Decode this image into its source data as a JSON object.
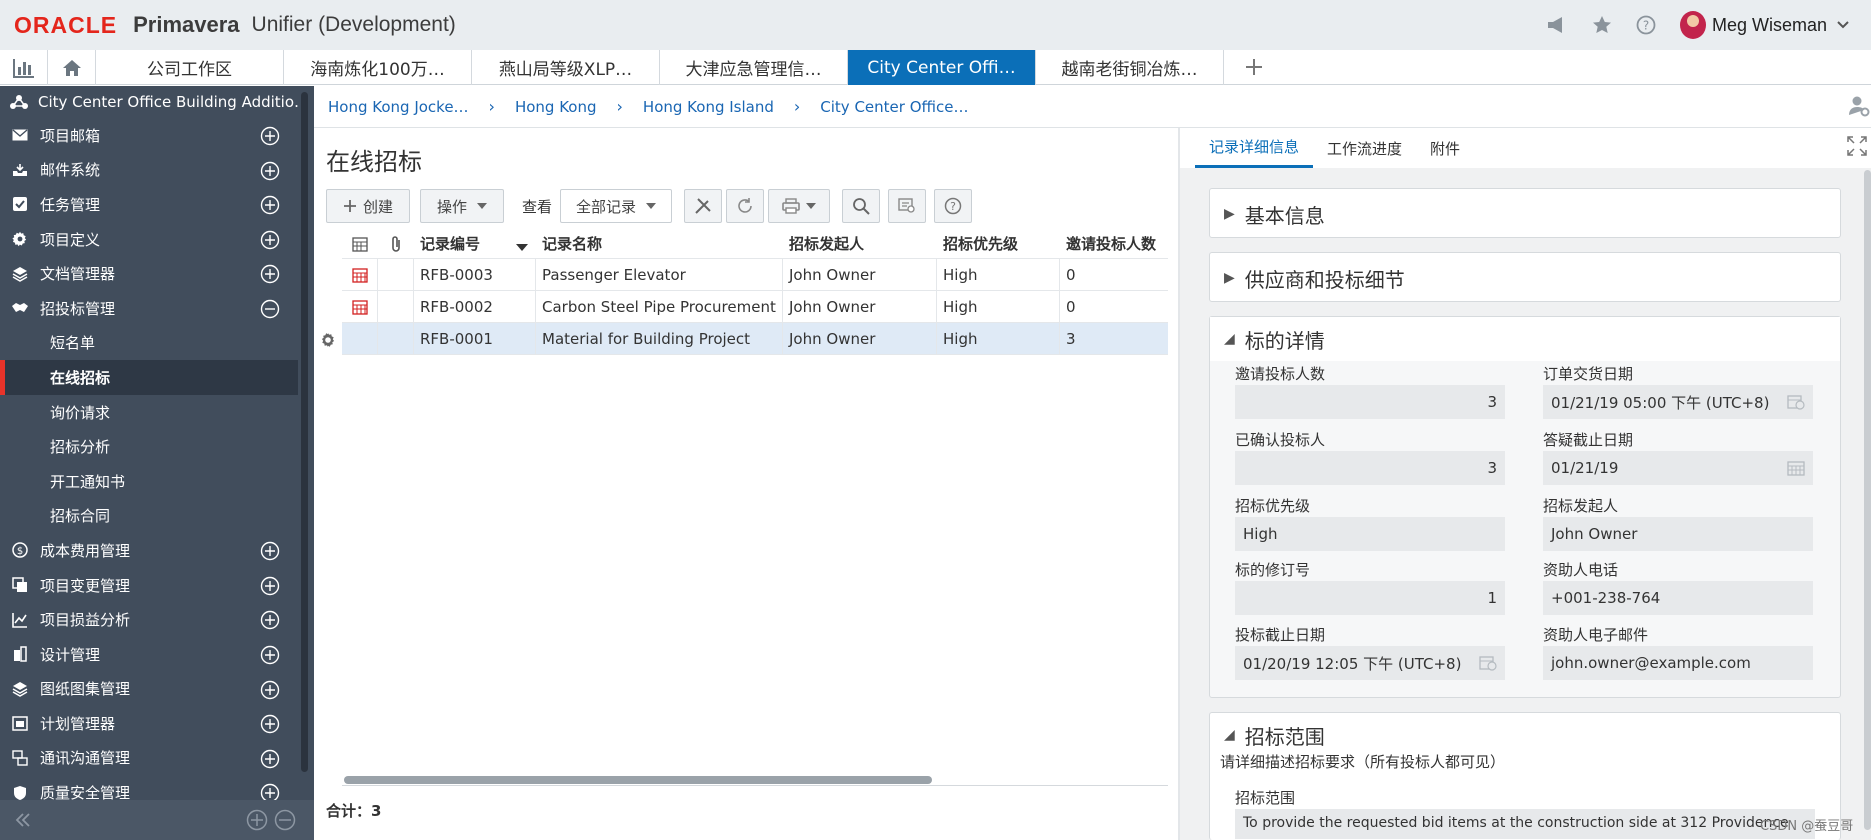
{
  "header": {
    "logo": "ORACLE",
    "product": "Primavera",
    "app_title": "Unifier  (Development)",
    "user_name": "Meg Wiseman"
  },
  "tabs": [
    {
      "label": "公司工作区",
      "active": false
    },
    {
      "label": "海南炼化100万…",
      "active": false
    },
    {
      "label": "燕山局等级XLP…",
      "active": false
    },
    {
      "label": "大津应急管理信…",
      "active": false
    },
    {
      "label": "City Center Offi…",
      "active": true
    },
    {
      "label": "越南老街铜冶炼…",
      "active": false
    }
  ],
  "sidebar": {
    "project": "City Center Office Building Additio…",
    "items": [
      {
        "label": "项目邮箱",
        "icon": "mail-icon"
      },
      {
        "label": "邮件系统",
        "icon": "inbox-icon"
      },
      {
        "label": "任务管理",
        "icon": "task-check-icon"
      },
      {
        "label": "项目定义",
        "icon": "gear-icon"
      },
      {
        "label": "文档管理器",
        "icon": "layers-icon"
      },
      {
        "label": "招投标管理",
        "icon": "handshake-icon",
        "expanded": true
      }
    ],
    "sub_items": [
      {
        "label": "短名单",
        "active": false
      },
      {
        "label": "在线招标",
        "active": true
      },
      {
        "label": "询价请求",
        "active": false
      },
      {
        "label": "招标分析",
        "active": false
      },
      {
        "label": "开工通知书",
        "active": false
      },
      {
        "label": "招标合同",
        "active": false
      }
    ],
    "items_after": [
      {
        "label": "成本费用管理",
        "icon": "dollar-icon"
      },
      {
        "label": "项目变更管理",
        "icon": "change-doc-icon"
      },
      {
        "label": "项目损益分析",
        "icon": "chart-icon"
      },
      {
        "label": "设计管理",
        "icon": "building-icon"
      },
      {
        "label": "图纸图集管理",
        "icon": "layers-icon"
      },
      {
        "label": "计划管理器",
        "icon": "schedule-icon"
      },
      {
        "label": "通讯沟通管理",
        "icon": "comm-icon"
      },
      {
        "label": "质量安全管理",
        "icon": "shield-icon"
      }
    ]
  },
  "breadcrumb": [
    "Hong Kong Jocke…",
    "Hong Kong",
    "Hong Kong Island",
    "City Center Office…"
  ],
  "main": {
    "title": "在线招标",
    "toolbar": {
      "create": "创建",
      "actions": "操作",
      "view_label": "查看",
      "view_value": "全部记录"
    },
    "columns": [
      "记录编号",
      "记录名称",
      "招标发起人",
      "招标优先级",
      "邀请投标人数"
    ],
    "rows": [
      {
        "id": "RFB-0003",
        "name": "Passenger Elevator",
        "creator": "John Owner",
        "priority": "High",
        "invited": "0",
        "flag": true,
        "selected": false
      },
      {
        "id": "RFB-0002",
        "name": "Carbon Steel Pipe Procurement",
        "creator": "John Owner",
        "priority": "High",
        "invited": "0",
        "flag": true,
        "selected": false
      },
      {
        "id": "RFB-0001",
        "name": "Material for Building Project",
        "creator": "John Owner",
        "priority": "High",
        "invited": "3",
        "flag": false,
        "selected": true
      }
    ],
    "total": "合计：3"
  },
  "detail": {
    "tabs": [
      {
        "label": "记录详细信息",
        "active": true
      },
      {
        "label": "工作流进度",
        "active": false
      },
      {
        "label": "附件",
        "active": false
      }
    ],
    "sections": {
      "basic": "基本信息",
      "supplier": "供应商和投标细节",
      "bid_details": "标的详情",
      "scope": "招标范围"
    },
    "fields": {
      "invited_label": "邀请投标人数",
      "invited_value": "3",
      "order_date_label": "订单交货日期",
      "order_date_value": "01/21/19 05:00 下午  (UTC+8)",
      "confirmed_label": "已确认投标人",
      "confirmed_value": "3",
      "qa_deadline_label": "答疑截止日期",
      "qa_deadline_value": "01/21/19",
      "priority_label": "招标优先级",
      "priority_value": "High",
      "creator_label": "招标发起人",
      "creator_value": "John Owner",
      "revision_label": "标的修订号",
      "revision_value": "1",
      "sponsor_phone_label": "资助人电话",
      "sponsor_phone_value": "+001-238-764",
      "bid_deadline_label": "投标截止日期",
      "bid_deadline_value": "01/20/19 12:05 下午  (UTC+8)",
      "sponsor_email_label": "资助人电子邮件",
      "sponsor_email_value": "john.owner@example.com"
    },
    "scope_desc": "请详细描述招标要求（所有投标人都可见）",
    "scope_field_label": "招标范围",
    "scope_field_value": "To provide the requested bid items at the construction side at 312 Providence"
  },
  "watermark": "CSDN @蚕豆哥",
  "colors": {
    "brand_red": "#e4261c",
    "active_tab": "#0b6fb8",
    "sidebar_bg": "#414d5c",
    "active_marker": "#e8332a"
  }
}
